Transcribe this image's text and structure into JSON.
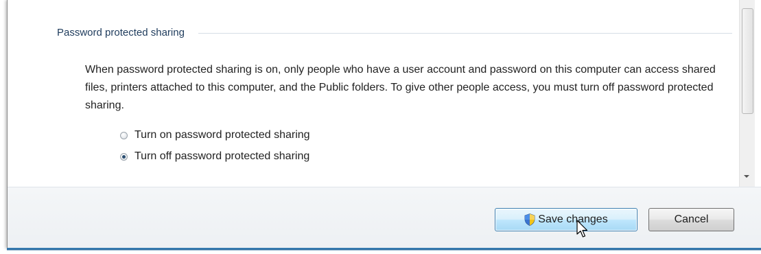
{
  "section": {
    "title": "Password protected sharing",
    "description": "When password protected sharing is on, only people who have a user account and password on this computer can access shared files, printers attached to this computer, and the Public folders. To give other people access, you must turn off password protected sharing."
  },
  "options": [
    {
      "label": "Turn on password protected sharing",
      "checked": false
    },
    {
      "label": "Turn off password protected sharing",
      "checked": true
    }
  ],
  "footer": {
    "save_label": "Save changes",
    "cancel_label": "Cancel"
  },
  "icons": {
    "save": "uac-shield-icon",
    "pointer": "mouse-cursor-icon"
  },
  "colors": {
    "accent_border": "#3c7fb1",
    "heading": "#1e3b5c"
  }
}
